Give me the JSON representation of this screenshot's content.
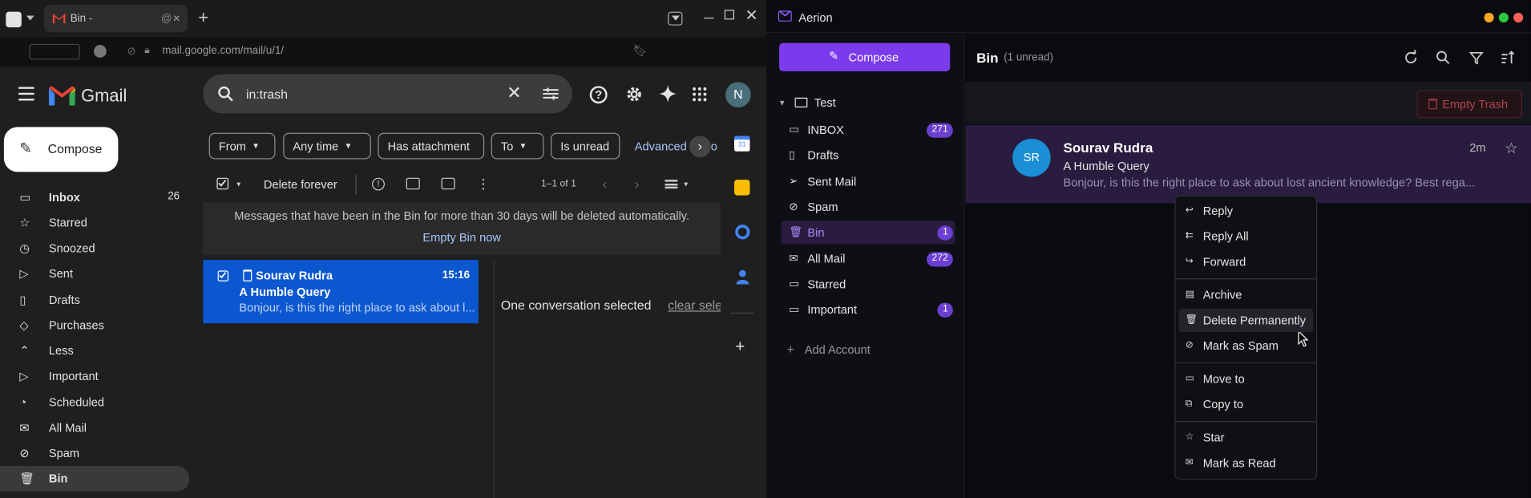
{
  "browser": {
    "tab_title": "Bin - ",
    "tab_suffix": "@",
    "url": "mail.google.com/mail/u/1/"
  },
  "gmail": {
    "brand": "Gmail",
    "search_value": "in:trash",
    "compose_label": "Compose",
    "avatar_letter": "N",
    "chips": [
      "From",
      "Any time",
      "Has attachment",
      "To",
      "Is unread"
    ],
    "advanced_label": "Advanced",
    "advanced_tail": "ro",
    "delete_forever": "Delete forever",
    "pagination": "1–1 of 1",
    "bin_notice": "Messages that have been in the Bin for more than 30 days will be deleted automatically.",
    "empty_bin_now": "Empty Bin now",
    "nav": [
      {
        "label": "Inbox",
        "count": "26",
        "icon": "inbox-icon"
      },
      {
        "label": "Starred",
        "icon": "star-icon"
      },
      {
        "label": "Snoozed",
        "icon": "clock-icon"
      },
      {
        "label": "Sent",
        "icon": "send-icon"
      },
      {
        "label": "Drafts",
        "icon": "draft-icon"
      },
      {
        "label": "Purchases",
        "icon": "tag-icon"
      },
      {
        "label": "Less",
        "icon": "chevron-up-icon"
      },
      {
        "label": "Important",
        "icon": "important-icon"
      },
      {
        "label": "Scheduled",
        "icon": "scheduled-icon"
      },
      {
        "label": "All Mail",
        "icon": "all-mail-icon"
      },
      {
        "label": "Spam",
        "icon": "spam-icon"
      },
      {
        "label": "Bin",
        "icon": "bin-icon"
      }
    ],
    "message": {
      "sender": "Sourav Rudra",
      "time": "15:16",
      "subject": "A Humble Query",
      "snippet": "Bonjour, is this the right place to ask about l..."
    },
    "selection_text": "One conversation selected",
    "clear_selection": "clear sele"
  },
  "aerion": {
    "title": "Aerion",
    "compose_label": "Compose",
    "account": "Test",
    "folders": [
      {
        "label": "INBOX",
        "badge": "271",
        "icon": "inbox-icon"
      },
      {
        "label": "Drafts",
        "icon": "draft-icon"
      },
      {
        "label": "Sent Mail",
        "icon": "send-icon"
      },
      {
        "label": "Spam",
        "icon": "spam-icon"
      },
      {
        "label": "Bin",
        "badge": "1",
        "icon": "bin-icon"
      },
      {
        "label": "All Mail",
        "badge": "272",
        "icon": "all-mail-icon"
      },
      {
        "label": "Starred",
        "icon": "folder-icon"
      },
      {
        "label": "Important",
        "badge": "1",
        "icon": "folder-icon"
      }
    ],
    "add_account": "Add Account",
    "header_title": "Bin",
    "header_unread": "(1 unread)",
    "empty_trash": "Empty Trash",
    "message": {
      "initials": "SR",
      "sender": "Sourav Rudra",
      "time": "2m",
      "subject": "A Humble Query",
      "snippet": "Bonjour, is this the right place to ask about lost ancient knowledge? Best rega..."
    },
    "context_menu": [
      "Reply",
      "Reply All",
      "Forward",
      "Archive",
      "Delete Permanently",
      "Mark as Spam",
      "Move to",
      "Copy to",
      "Star",
      "Mark as Read"
    ]
  },
  "colors": {
    "gmail_accent": "#0b57d0",
    "aerion_accent": "#7c3aed",
    "aerion_badge": "#6b3fd1"
  }
}
